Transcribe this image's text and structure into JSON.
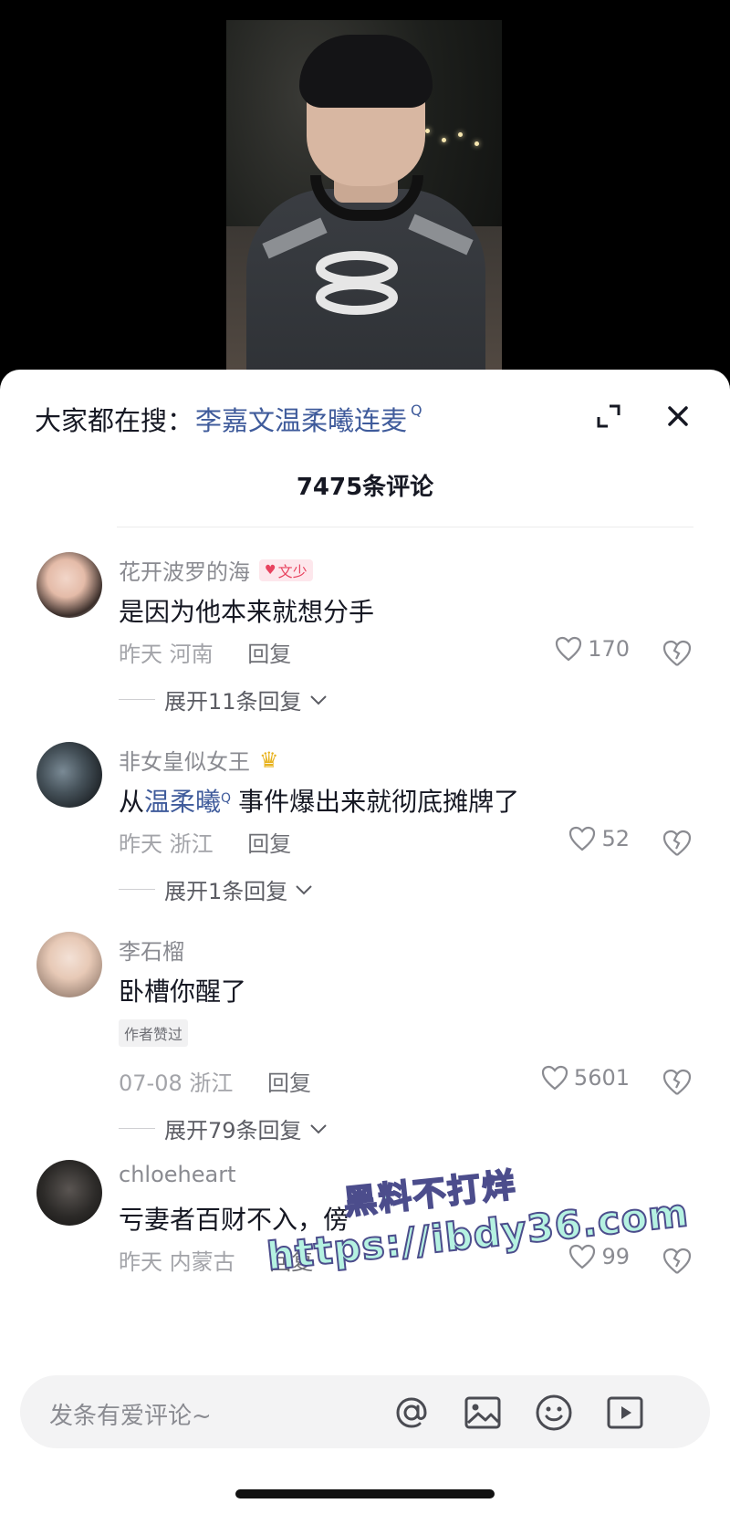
{
  "search": {
    "prefix": "大家都在搜：",
    "term": "李嘉文温柔曦连麦"
  },
  "header": {
    "comment_count": "7475条评论"
  },
  "comments": [
    {
      "username": "花开波罗的海",
      "badge": "文少",
      "content": "是因为他本来就想分手",
      "time": "昨天",
      "location": "河南",
      "reply_label": "回复",
      "likes": "170",
      "expand": "展开11条回复"
    },
    {
      "username": "非女皇似女王",
      "badge_icon": "crown-icon",
      "content_link": "温柔曦",
      "content_pre": "从",
      "content_post": "事件爆出来就彻底摊牌了",
      "time": "昨天",
      "location": "浙江",
      "reply_label": "回复",
      "likes": "52",
      "expand": "展开1条回复"
    },
    {
      "username": "李石榴",
      "content": "卧槽你醒了",
      "author_tag": "作者赞过",
      "time": "07-08",
      "location": "浙江",
      "reply_label": "回复",
      "likes": "5601",
      "expand": "展开79条回复"
    },
    {
      "username": "chloeheart",
      "content": "亏妻者百财不入，傍",
      "time": "昨天",
      "location": "内蒙古",
      "reply_label": "回复",
      "likes": "99"
    }
  ],
  "watermark": {
    "line1": "黑料不打烊",
    "line2": "https://ibdy36.com"
  },
  "input": {
    "placeholder": "发条有爱评论~"
  },
  "colors": {
    "link": "#3f5b9b",
    "badge_pink": "#e8435f",
    "watermark_fill": "#b5f2e1"
  }
}
